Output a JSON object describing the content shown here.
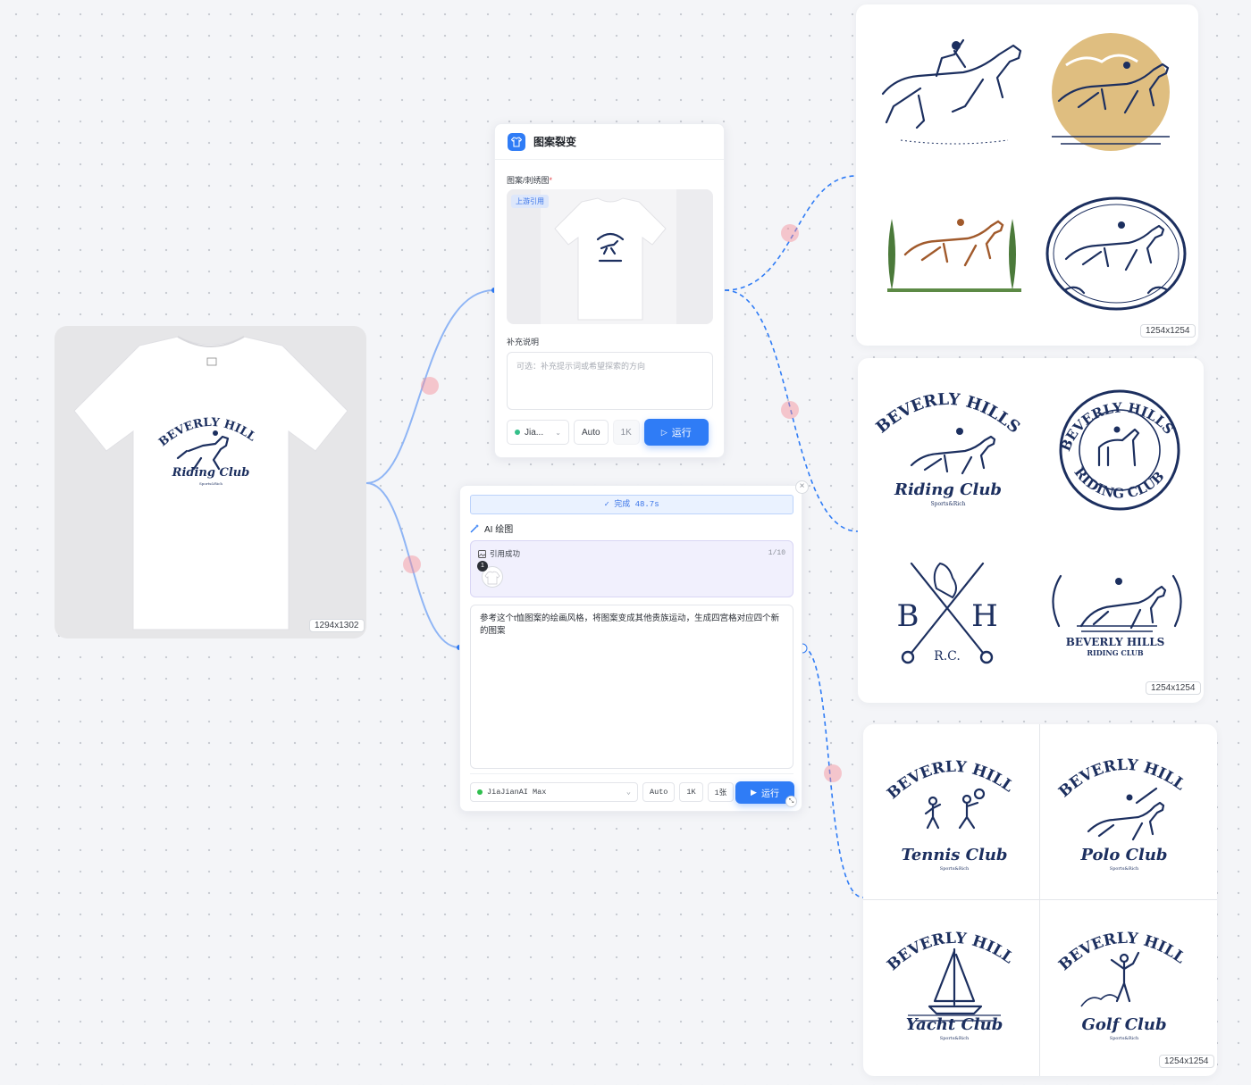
{
  "source_image": {
    "size_label": "1294x1302",
    "shirt_text": {
      "arc": "BEVERLY HILLS",
      "script": "Riding Club",
      "small": "Sports&Rich"
    }
  },
  "node_pattern": {
    "title": "图案裂变",
    "field_label": "图案/刺绣图",
    "required_mark": "*",
    "ref_tag": "上游引用",
    "notes_label": "补充说明",
    "notes_placeholder": "可选：补充提示词或希望探索的方向",
    "model_label": "Jia...",
    "ratio_label": "Auto",
    "res_label": "1K",
    "run_label": "运行"
  },
  "node_ai": {
    "status": "✓ 完成 48.7s",
    "title": "AI 绘图",
    "ref_label": "引用成功",
    "ref_count": "1/10",
    "ref_index": "1",
    "prompt": "参考这个t恤图案的绘画风格，将图案变成其他贵族运动，生成四宫格对应四个新的图案",
    "model_label": "JiaJianAI Max",
    "ratio_label": "Auto",
    "res_label": "1K",
    "count_label": "1张",
    "run_label": "运行"
  },
  "output_1": {
    "size_label": "1254x1254"
  },
  "output_2": {
    "size_label": "1254x1254",
    "items": {
      "arc1": "BEVERLY HILLS",
      "script1": "Riding Club",
      "small1": "Sports&Rich",
      "arc2": "BEVERLY HILLS",
      "bottom2": "RIDING CLUB",
      "b": "B",
      "h": "H",
      "rc": "R.C.",
      "name4": "BEVERLY HILLS",
      "sub4": "RIDING CLUB"
    }
  },
  "output_3": {
    "size_label": "1254x1254",
    "tiles": [
      {
        "arc": "BEVERLY HILLS",
        "script": "Tennis Club",
        "small": "Sports&Rich"
      },
      {
        "arc": "BEVERLY HILLS",
        "script": "Polo Club",
        "small": "Sports&Rich"
      },
      {
        "arc": "BEVERLY HILLS",
        "script": "Yacht Club",
        "small": "Sports&Rich"
      },
      {
        "arc": "BEVERLY HILLS",
        "script": "Golf Club",
        "small": "Sports&Rich"
      }
    ]
  },
  "colors": {
    "accent": "#2f7cf6",
    "navy": "#1c2f5f",
    "connector": "#f58c96",
    "success": "#35c08a"
  }
}
